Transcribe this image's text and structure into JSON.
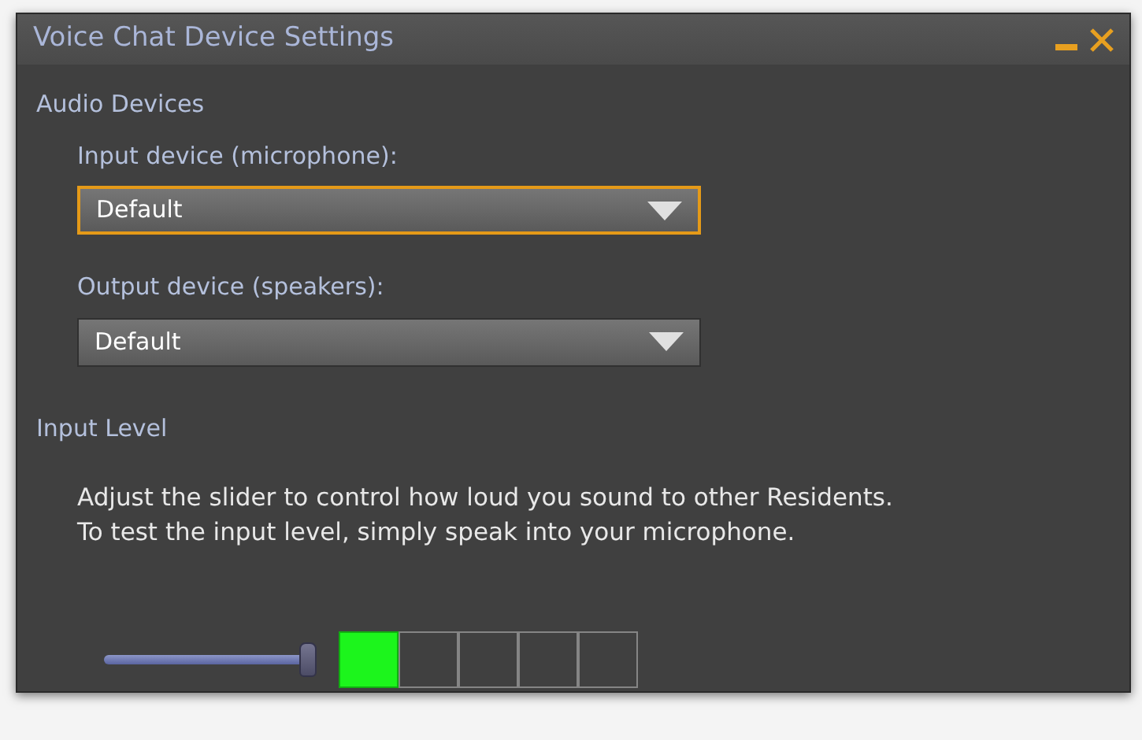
{
  "window": {
    "title": "Voice Chat Device Settings",
    "buttons": [
      {
        "kind": "minimize"
      },
      {
        "kind": "close"
      }
    ]
  },
  "audio_devices": {
    "heading": "Audio Devices",
    "fields": [
      {
        "label": "Input device (microphone):",
        "value": "Default",
        "focused": true
      },
      {
        "label": "Output device (speakers):",
        "value": "Default",
        "focused": false
      }
    ]
  },
  "input_level": {
    "heading": "Input Level",
    "description": [
      "Adjust the slider to control how loud you sound to other Residents.",
      "To test the input level, simply speak into your microphone."
    ],
    "slider": {
      "level": 1.0
    },
    "meter": {
      "level": 0.2
    }
  }
}
